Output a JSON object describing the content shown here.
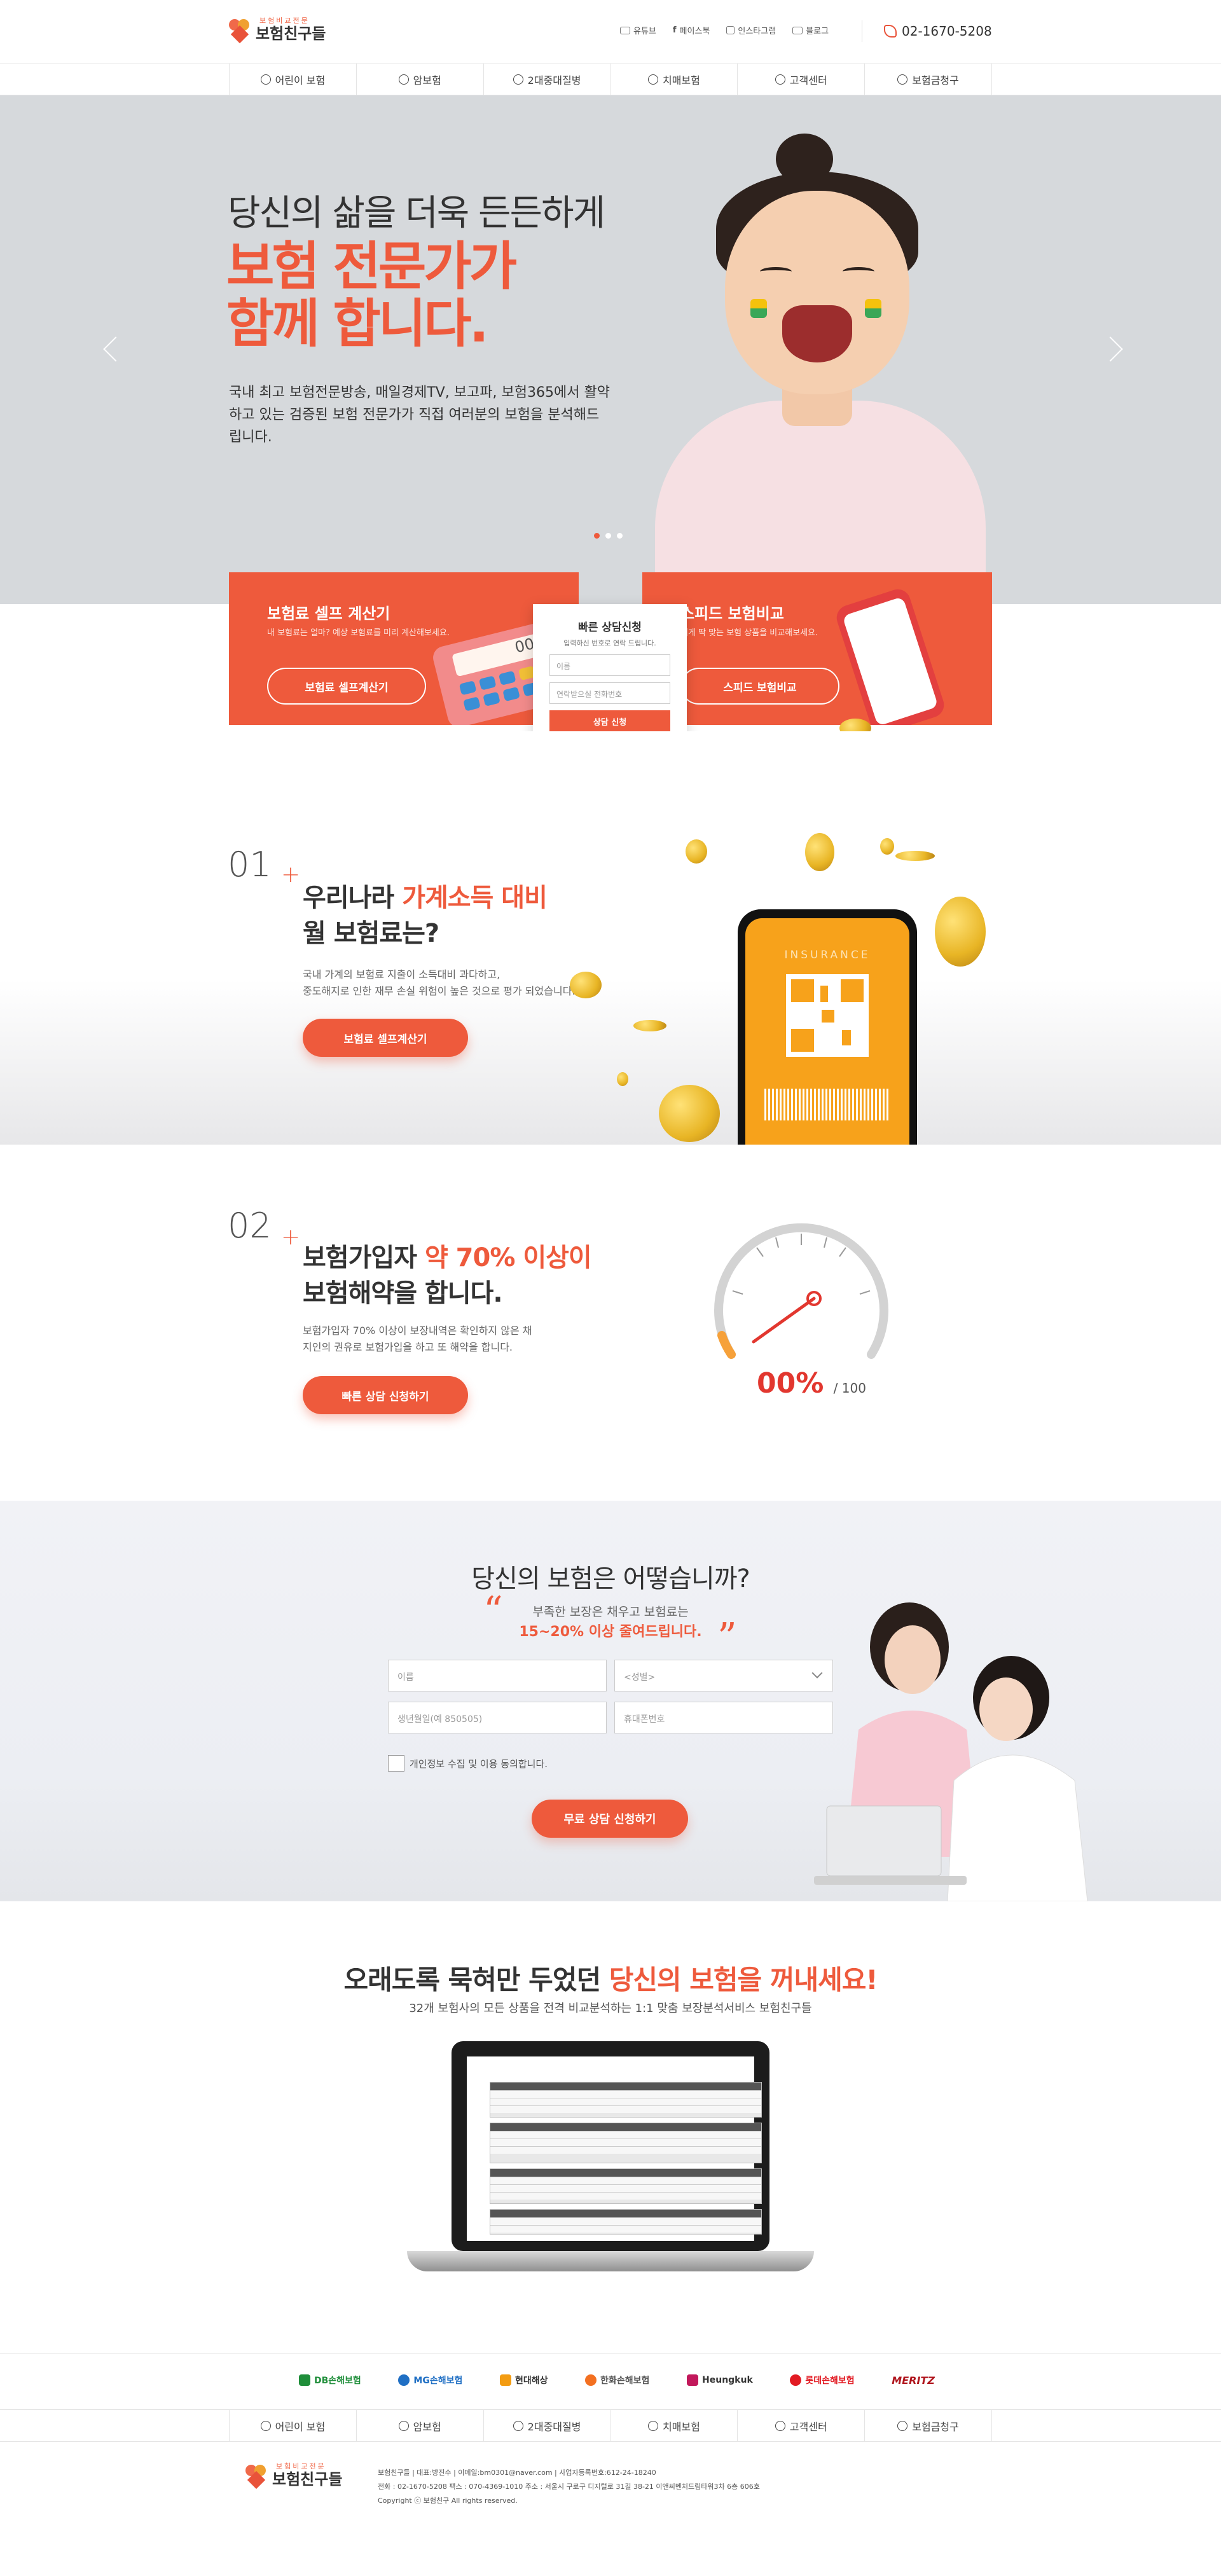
{
  "header": {
    "logo_sub": "보험비교전문",
    "logo_main": "보험친구들",
    "social": [
      "유튜브",
      "페이스북",
      "인스타그램",
      "블로그"
    ],
    "phone": "02-1670-5208"
  },
  "nav": {
    "items": [
      "어린이 보험",
      "암보험",
      "2대중대질병",
      "치매보험",
      "고객센터",
      "보험금청구"
    ]
  },
  "hero": {
    "subtitle": "당신의 삶을 더욱 든든하게",
    "title_line1": "보험 전문가가",
    "title_line2": "함께 합니다.",
    "description": "국내 최고 보험전문방송, 매일경제TV, 보고파, 보험365에서 활약하고 있는 검증된 보험 전문가가 직접 여러분의 보험을 분석해드립니다.",
    "slides_total": 3,
    "slide_active": 1
  },
  "promo": {
    "calc": {
      "title": "보험료 셀프 계산기",
      "desc": "내 보험료는 얼마? 예상 보험료를 미리 계산해보세요.",
      "button": "보험료 셀프계산기",
      "screen": "00"
    },
    "quick": {
      "title": "빠른 상담신청",
      "desc": "입력하신 번호로 연락 드립니다.",
      "name_placeholder": "이름",
      "phone_placeholder": "연락받으실 전화번호",
      "button": "상담 신청"
    },
    "compare": {
      "title": "스피드 보험비교",
      "desc": "내게 딱 맞는 보험 상품을 비교해보세요.",
      "button": "스피드 보험비교"
    }
  },
  "section01": {
    "number": "01",
    "title_a": "우리나라 ",
    "title_hl": "가계소득 대비",
    "title_b": "월 보험료는?",
    "desc_line1": "국내 가계의 보험료 지출이 소득대비 과다하고,",
    "desc_line2": "중도해지로 인한 재무 손실 위험이 높은 것으로 평가 되었습니다.",
    "button": "보험료 셀프계산기",
    "phone_label": "INSURANCE"
  },
  "section02": {
    "number": "02",
    "title_a": "보험가입자 ",
    "title_hl": "약 70% 이상이",
    "title_b": "보험해약을 합니다.",
    "desc_line1": "보험가입자 70% 이상이 보장내역은 확인하지 않은 채",
    "desc_line2": "지인의 권유로 보험가입을 하고 또 해약을 합니다.",
    "button": "빠른 상담 신청하기",
    "gauge_value": "00%",
    "gauge_total": "/ 100"
  },
  "consult": {
    "title": "당신의 보험은 어떻습니까?",
    "sub": "부족한 보장은 채우고 보험료는",
    "highlight": "15~20% 이상 줄여드립니다.",
    "name_placeholder": "이름",
    "gender_placeholder": "<성별>",
    "birth_placeholder": "생년월일(예 850505)",
    "phone_placeholder": "휴대폰번호",
    "agree": "개인정보 수집 및 이용 동의합니다.",
    "button": "무료 상담 신청하기"
  },
  "analysis": {
    "title_a": "오래도록 묵혀만 두었던 ",
    "title_hl": "당신의 보험을 꺼내세요!",
    "sub": "32개 보험사의 모든 상품을 전격 비교분석하는 1:1 맞춤 보장분석서비스 보험친구들"
  },
  "partners": [
    {
      "name": "DB손해보험",
      "color": "#1f8e3a"
    },
    {
      "name": "MG손해보험",
      "color": "#1f6fc4"
    },
    {
      "name": "현대해상",
      "color": "#f39c12"
    },
    {
      "name": "한화손해보험",
      "color": "#f37021"
    },
    {
      "name": "Heungkuk",
      "color": "#c2185b"
    },
    {
      "name": "롯데손해보험",
      "color": "#e21b23"
    },
    {
      "name": "MERITZ",
      "color": "#b0171f"
    }
  ],
  "footer": {
    "logo_sub": "보험비교전문",
    "logo_main": "보험친구들",
    "line1": "보험친구들 | 대표:방진수 | 이메일:bm0301@naver.com | 사업자등록번호:612-24-18240",
    "line2": "전화 : 02-1670-5208 팩스 : 070-4369-1010 주소 : 서울시 구로구 디지털로 31길 38-21 이앤씨벤처드림타워3차 6층 606호",
    "line3": "Copyright ⓒ 보험친구 All rights reserved."
  },
  "colors": {
    "accent": "#ee5a3c",
    "hero_bg": "#d6d9dc"
  }
}
